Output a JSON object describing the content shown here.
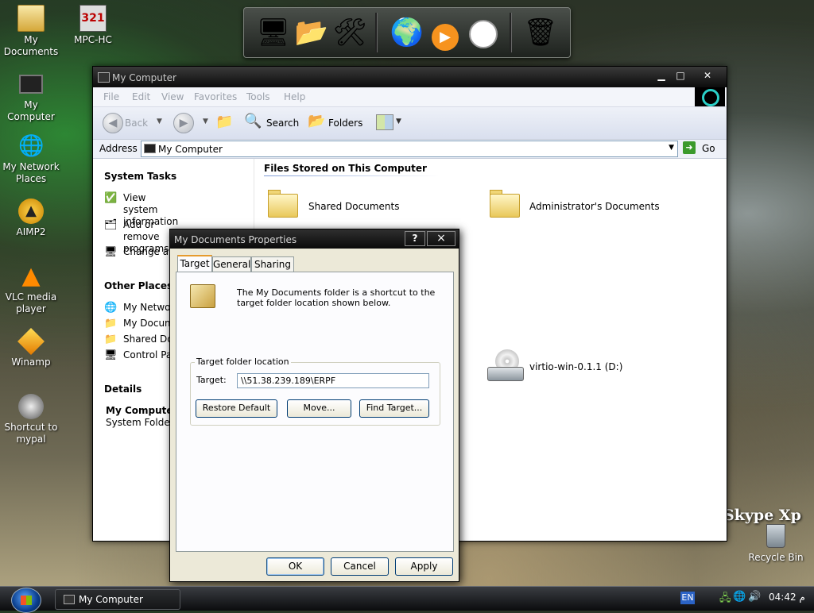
{
  "desktop": {
    "icons": [
      {
        "label": "My\nDocuments",
        "icon": "folder-docs-icon"
      },
      {
        "label": "MPC-HC",
        "icon": "media-player-icon"
      },
      {
        "label": "My Computer",
        "icon": "computer-icon"
      },
      {
        "label": "My Network\nPlaces",
        "icon": "network-icon"
      },
      {
        "label": "AIMP2",
        "icon": "aimp-icon"
      },
      {
        "label": "VLC media\nplayer",
        "icon": "vlc-cone-icon"
      },
      {
        "label": "Winamp",
        "icon": "winamp-icon"
      },
      {
        "label": "Shortcut to\nmypal",
        "icon": "raccoon-icon"
      },
      {
        "label": "Recycle Bin",
        "icon": "recycle-bin-icon"
      }
    ],
    "watermark": "Skype Xp"
  },
  "dock": {
    "items": [
      "computer-icon",
      "folders-icon",
      "control-panel-icon",
      "globe-icon",
      "media-play-icon",
      "clock-icon",
      "trash-icon"
    ]
  },
  "explorer": {
    "title": "My Computer",
    "menu": [
      "File",
      "Edit",
      "View",
      "Favorites",
      "Tools",
      "Help"
    ],
    "toolbar": {
      "back": "Back",
      "search": "Search",
      "folders": "Folders"
    },
    "address": {
      "label": "Address",
      "value": "My Computer",
      "go": "Go"
    },
    "sidebar": {
      "system_tasks": {
        "title": "System Tasks",
        "items": [
          "View system\ninformation",
          "Add or remove\nprograms",
          "Change a"
        ]
      },
      "other_places": {
        "title": "Other Places",
        "items": [
          "My Networ",
          "My Docum",
          "Shared Do",
          "Control Pa"
        ]
      },
      "details": {
        "title": "Details",
        "name": "My Computer",
        "type": "System Folder"
      }
    },
    "content": {
      "section_title": "Files Stored on This Computer",
      "items": [
        "Shared Documents",
        "Administrator's Documents"
      ],
      "drive": "virtio-win-0.1.1 (D:)"
    }
  },
  "dialog": {
    "title": "My Documents Properties",
    "help": "?",
    "close": "×",
    "tabs": [
      "Target",
      "General",
      "Sharing"
    ],
    "description": "The My Documents folder is a shortcut to the target folder location shown below.",
    "group_label": "Target folder location",
    "target_label": "Target:",
    "target_value": "\\\\51.38.239.189\\ERPF",
    "buttons": {
      "restore": "Restore Default",
      "move": "Move...",
      "find": "Find Target..."
    },
    "footer": {
      "ok": "OK",
      "cancel": "Cancel",
      "apply": "Apply"
    }
  },
  "taskbar": {
    "task": "My Computer",
    "language": "EN",
    "time": "04:42 م"
  }
}
